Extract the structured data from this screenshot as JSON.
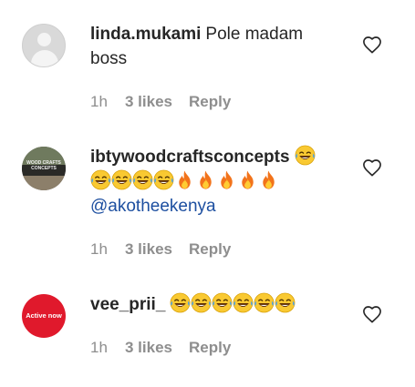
{
  "comments": [
    {
      "username": "linda.mukami",
      "text": "Pole madam boss",
      "time": "1h",
      "likes": "3 likes",
      "reply": "Reply",
      "avatar_icon": "default-user-avatar"
    },
    {
      "username": "ibtywoodcraftsconcepts",
      "emojis": "😂😂😂😂😂🔥🔥🔥🔥🔥",
      "mention": "@akotheekenya",
      "time": "1h",
      "likes": "3 likes",
      "reply": "Reply",
      "avatar_text": "WOOD CRAFTS CONCEPTS"
    },
    {
      "username": "vee_prii_",
      "emojis": "😂😂😂😂😂😂",
      "time": "1h",
      "likes": "3 likes",
      "reply": "Reply",
      "avatar_text": "Active now"
    }
  ],
  "icons": {
    "like": "heart-outline-icon"
  },
  "colors": {
    "mention": "#1d4fa0",
    "meta": "#8e8e8e",
    "active_avatar": "#e0192c"
  }
}
